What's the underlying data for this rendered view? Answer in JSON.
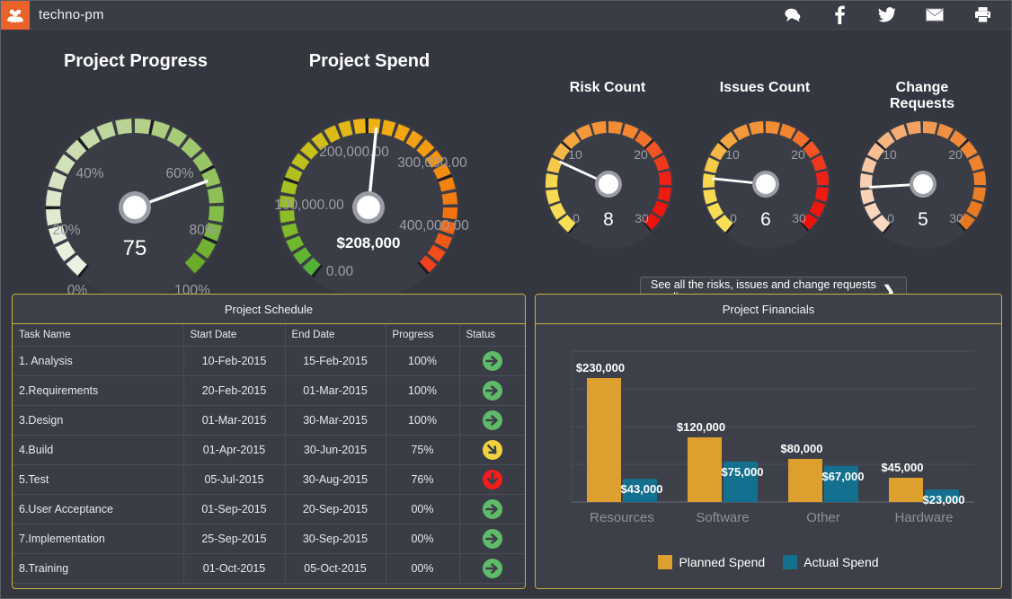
{
  "header": {
    "title": "techno-pm",
    "logo_icon": "users-group-icon",
    "logo_color": "#e8622a",
    "icons": [
      {
        "name": "comment-icon",
        "label": "Comments"
      },
      {
        "name": "facebook-icon",
        "label": "Facebook"
      },
      {
        "name": "twitter-icon",
        "label": "Twitter"
      },
      {
        "name": "email-icon",
        "label": "Email"
      },
      {
        "name": "print-icon",
        "label": "Print"
      }
    ]
  },
  "gauges": [
    {
      "id": "project-progress",
      "title": "Project Progress",
      "value": 75,
      "value_display": "75",
      "min": 0,
      "max": 100,
      "ticks": [
        "0%",
        "20%",
        "40%",
        "60%",
        "80%",
        "100%"
      ],
      "colors": [
        "#eef3e6",
        "#dde8cc",
        "#c3d9a3",
        "#a9cc7b",
        "#8dbf53",
        "#66aa22"
      ]
    },
    {
      "id": "project-spend",
      "title": "Project Spend",
      "value": 208000,
      "value_display": "$208,000",
      "min": 0,
      "max": 400000,
      "ticks": [
        "0.00",
        "100,000.00",
        "200,000.00",
        "300,000.00",
        "400,000.00"
      ],
      "colors": [
        "#4caf3a",
        "#8fbe25",
        "#c9c01b",
        "#f0b415",
        "#f59a10",
        "#f4740d",
        "#ee3b20"
      ]
    },
    {
      "id": "risk-count",
      "title": "Risk Count",
      "value": 8,
      "value_display": "8",
      "min": 0,
      "max": 30,
      "ticks": [
        "0",
        "10",
        "20",
        "30"
      ],
      "colors": [
        "#f6e05e",
        "#f5a councils"
      ]
    },
    {
      "id": "issues-count",
      "title": "Issues Count",
      "value": 6,
      "value_display": "6",
      "min": 0,
      "max": 30,
      "ticks": [
        "0",
        "10",
        "20",
        "30"
      ]
    },
    {
      "id": "change-requests",
      "title": "Change\nRequests",
      "value": 5,
      "value_display": "5",
      "min": 0,
      "max": 30,
      "ticks": [
        "0",
        "10",
        "20",
        "30"
      ]
    }
  ],
  "see_all_button": {
    "label": "See all the risks, issues and change requests pending",
    "chevron": "❯"
  },
  "schedule": {
    "panel_title": "Project Schedule",
    "columns": [
      "Task Name",
      "Start Date",
      "End Date",
      "Progress",
      "Status"
    ],
    "rows": [
      {
        "task": "1. Analysis",
        "start": "10-Feb-2015",
        "end": "15-Feb-2015",
        "progress": "100%",
        "status": "green-right-arrow-icon"
      },
      {
        "task": "2.Requirements",
        "start": "20-Feb-2015",
        "end": "01-Mar-2015",
        "progress": "100%",
        "status": "green-right-arrow-icon"
      },
      {
        "task": "3.Design",
        "start": "01-Mar-2015",
        "end": "30-Mar-2015",
        "progress": "100%",
        "status": "green-right-arrow-icon"
      },
      {
        "task": "4.Build",
        "start": "01-Apr-2015",
        "end": "30-Jun-2015",
        "progress": "75%",
        "status": "yellow-down-right-arrow-icon"
      },
      {
        "task": "5.Test",
        "start": "05-Jul-2015",
        "end": "30-Aug-2015",
        "progress": "76%",
        "status": "red-down-arrow-icon"
      },
      {
        "task": "6.User Acceptance",
        "start": "01-Sep-2015",
        "end": "20-Sep-2015",
        "progress": "00%",
        "status": "green-right-arrow-icon"
      },
      {
        "task": "7.Implementation",
        "start": "25-Sep-2015",
        "end": "30-Sep-2015",
        "progress": "00%",
        "status": "green-right-arrow-icon"
      },
      {
        "task": "8.Training",
        "start": "01-Oct-2015",
        "end": "05-Oct-2015",
        "progress": "00%",
        "status": "green-right-arrow-icon"
      }
    ]
  },
  "financials": {
    "panel_title": "Project Financials"
  },
  "chart_data": {
    "type": "bar",
    "title": "Project Financials",
    "categories": [
      "Resources",
      "Software",
      "Other",
      "Hardware"
    ],
    "series": [
      {
        "name": "Planned Spend",
        "color": "#dda02e",
        "values": [
          230000,
          120000,
          80000,
          45000
        ],
        "labels": [
          "$230,000",
          "$120,000",
          "$80,000",
          "$45,000"
        ]
      },
      {
        "name": "Actual Spend",
        "color": "#14708f",
        "values": [
          43000,
          75000,
          67000,
          23000
        ],
        "labels": [
          "$43,000",
          "$75,000",
          "$67,000",
          "$23,000"
        ]
      }
    ],
    "xlabel": "",
    "ylabel": "",
    "ylim": [
      0,
      280000
    ],
    "grid": true,
    "legend_position": "bottom"
  }
}
